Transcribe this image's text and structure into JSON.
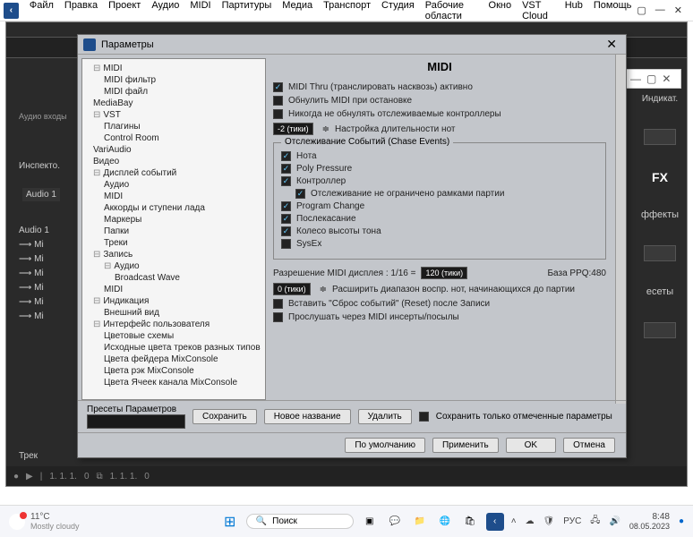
{
  "menubar": {
    "items": [
      "Файл",
      "Правка",
      "Проект",
      "Аудио",
      "MIDI",
      "Партитуры",
      "Медиа",
      "Транспорт",
      "Студия",
      "Рабочие области",
      "Окно",
      "VST Cloud",
      "Hub",
      "Помощь"
    ]
  },
  "app": {
    "inspector_label": "Инспекто.",
    "indicator_label": "Индикат.",
    "audio_in_label": "Аудио входы",
    "audio_track1": "Audio 1",
    "audio_folder": "Audio 1",
    "tracks": [
      "Mi",
      "Mi",
      "Mi",
      "Mi",
      "Mi",
      "Mi"
    ],
    "track_header": "Трек",
    "right_fx": "FX",
    "right_effects": "ффекты",
    "right_presets": "есеты",
    "transport": {
      "bar1": "1. 1. 1.",
      "pos": "0",
      "bar2": "1. 1. 1.",
      "pos2": "0"
    }
  },
  "prefs": {
    "title": "Параметры",
    "tree": {
      "root": "MIDI",
      "midi_filter": "MIDI фильтр",
      "midi_file": "MIDI файл",
      "mediabay": "MediaBay",
      "vst": "VST",
      "plugins": "Плагины",
      "control_room": "Control Room",
      "variaudio": "VariAudio",
      "video": "Видео",
      "event_display": "Дисплей событий",
      "ed_audio": "Аудио",
      "ed_midi": "MIDI",
      "ed_chords": "Аккорды и ступени лада",
      "ed_markers": "Маркеры",
      "ed_folders": "Папки",
      "ed_tracks": "Треки",
      "record": "Запись",
      "rec_audio": "Аудио",
      "rec_bwave": "Broadcast Wave",
      "rec_midi": "MIDI",
      "indication": "Индикация",
      "ind_appearance": "Внешний вид",
      "ui": "Интерфейс пользователя",
      "ui_color_schemes": "Цветовые схемы",
      "ui_track_colors": "Исходные цвета треков разных типов",
      "ui_fader_colors": "Цвета фейдера MixConsole",
      "ui_rack_colors": "Цвета рэк MixConsole",
      "ui_cell_colors": "Цвета Ячеек канала MixConsole"
    },
    "page_title": "MIDI",
    "opts": {
      "midi_thru": "MIDI Thru (транслировать насквозь) активно",
      "reset_on_stop": "Обнулить MIDI при остановке",
      "never_reset": "Никогда не обнулять отслеживаемые контроллеры",
      "length_adjust_val": "-2 (тики)",
      "length_adjust_lbl": "Настройка длительности нот",
      "chase_group_title": "Отслеживание Событий (Chase Events)",
      "chase_note": "Нота",
      "chase_poly": "Poly Pressure",
      "chase_ctrl": "Контроллер",
      "chase_unlimited": "Отслеживание не ограничено рамками партии",
      "chase_pc": "Program Change",
      "chase_after": "Послекасание",
      "chase_pitch": "Колесо высоты тона",
      "chase_sysex": "SysEx",
      "disp_res_lbl": "Разрешение MIDI дисплея : 1/16 =",
      "disp_res_val": "120 (тики)",
      "ppq_lbl": "База PPQ:480",
      "extend_val": "0 (тики)",
      "extend_lbl": "Расширить диапазон воспр. нот, начинающихся до партии",
      "insert_reset": "Вставить \"Сброс событий\" (Reset) после Записи",
      "audition": "Прослушать через MIDI инсерты/посылы"
    },
    "presets": {
      "label": "Пресеты Параметров",
      "save": "Сохранить",
      "new_name": "Новое название",
      "delete": "Удалить",
      "save_marked": "Сохранить только отмеченные параметры"
    },
    "buttons": {
      "defaults": "По умолчанию",
      "apply": "Применить",
      "ok": "OK",
      "cancel": "Отмена"
    }
  },
  "taskbar": {
    "temp": "11°C",
    "weather": "Mostly cloudy",
    "search": "Поиск",
    "lang": "РУС",
    "time": "8:48",
    "date": "08.05.2023"
  }
}
